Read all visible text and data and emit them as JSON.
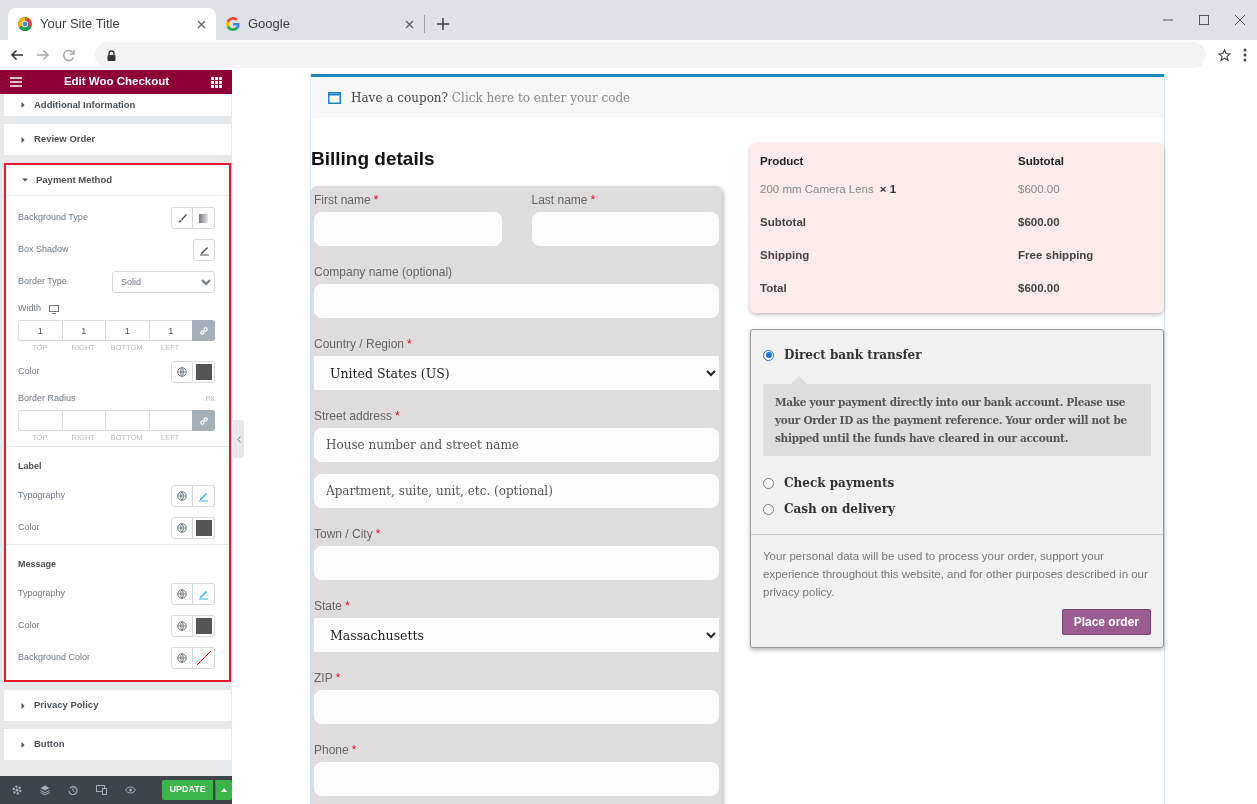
{
  "browser": {
    "tabs": [
      {
        "title": "Your Site Title",
        "selected": true
      },
      {
        "title": "Google",
        "selected": false
      }
    ]
  },
  "editor": {
    "title": "Edit Woo Checkout",
    "sections": [
      {
        "title": "Additional Information",
        "expanded": false
      },
      {
        "title": "Review Order",
        "expanded": false
      },
      {
        "title": "Payment Method",
        "expanded": true,
        "highlighted": true,
        "controls": [
          {
            "kind": "background_type",
            "label": "Background Type"
          },
          {
            "kind": "popover",
            "label": "Box Shadow"
          },
          {
            "kind": "select",
            "label": "Border Type",
            "value": "Solid"
          },
          {
            "kind": "dimensions",
            "label": "Width",
            "responsive": true,
            "values": [
              "1",
              "1",
              "1",
              "1"
            ],
            "sides": [
              "TOP",
              "RIGHT",
              "BOTTOM",
              "LEFT"
            ]
          },
          {
            "kind": "color",
            "label": "Color",
            "color": "#555555"
          },
          {
            "kind": "dimensions",
            "label": "Border Radius",
            "unit": "PX",
            "sides": [
              "TOP",
              "RIGHT",
              "BOTTOM",
              "LEFT"
            ]
          },
          {
            "kind": "heading",
            "label": "Label"
          },
          {
            "kind": "typography",
            "label": "Typography"
          },
          {
            "kind": "color",
            "label": "Color",
            "color": "#555555"
          },
          {
            "kind": "heading",
            "label": "Message"
          },
          {
            "kind": "typography",
            "label": "Typography"
          },
          {
            "kind": "color",
            "label": "Color",
            "color": "#555555"
          },
          {
            "kind": "color",
            "label": "Background Color"
          }
        ]
      },
      {
        "title": "Privacy Policy",
        "expanded": false
      },
      {
        "title": "Button",
        "expanded": false
      }
    ],
    "update_button": "UPDATE"
  },
  "checkout": {
    "coupon": {
      "prompt": "Have a coupon?",
      "link": "Click here to enter your code"
    },
    "billing_title": "Billing details",
    "fields": [
      {
        "kind": "pair",
        "fields": [
          {
            "kind": "input",
            "label": "First name",
            "mark": "*"
          },
          {
            "kind": "input",
            "label": "Last name",
            "mark": "*"
          }
        ]
      },
      {
        "kind": "input",
        "label": "Company name (optional)"
      },
      {
        "kind": "select",
        "label": "Country / Region",
        "mark": "*",
        "value": "United States (US)"
      },
      {
        "kind": "input",
        "label": "Street address",
        "mark": "*",
        "placeholders": [
          "House number and street name",
          "Apartment, suite, unit, etc. (optional)"
        ]
      },
      {
        "kind": "input",
        "label": "Town / City",
        "mark": "*"
      },
      {
        "kind": "select",
        "label": "State",
        "mark": "*",
        "value": "Massachusetts"
      },
      {
        "kind": "input",
        "label": "ZIP",
        "mark": "*"
      },
      {
        "kind": "input",
        "label": "Phone",
        "mark": "*"
      }
    ],
    "order": {
      "columns": [
        "Product",
        "Subtotal"
      ],
      "item": {
        "name": "200 mm Camera Lens",
        "quantity": "× 1",
        "price": "$600.00"
      },
      "totals": [
        {
          "label": "Subtotal",
          "value": "$600.00"
        },
        {
          "label": "Shipping",
          "value": "Free shipping"
        },
        {
          "label": "Total",
          "value": "$600.00"
        }
      ]
    },
    "payment_methods": [
      {
        "label": "Direct bank transfer",
        "selected": true,
        "description": "Make your payment directly into our bank account. Please use your Order ID as the payment reference. Your order will not be shipped until the funds have cleared in our account."
      },
      {
        "label": "Check payments",
        "selected": false
      },
      {
        "label": "Cash on delivery",
        "selected": false
      }
    ],
    "privacy_text": "Your personal data will be used to process your order, support your experience throughout this website, and for other purposes described in our privacy policy.",
    "place_order": "Place order"
  }
}
